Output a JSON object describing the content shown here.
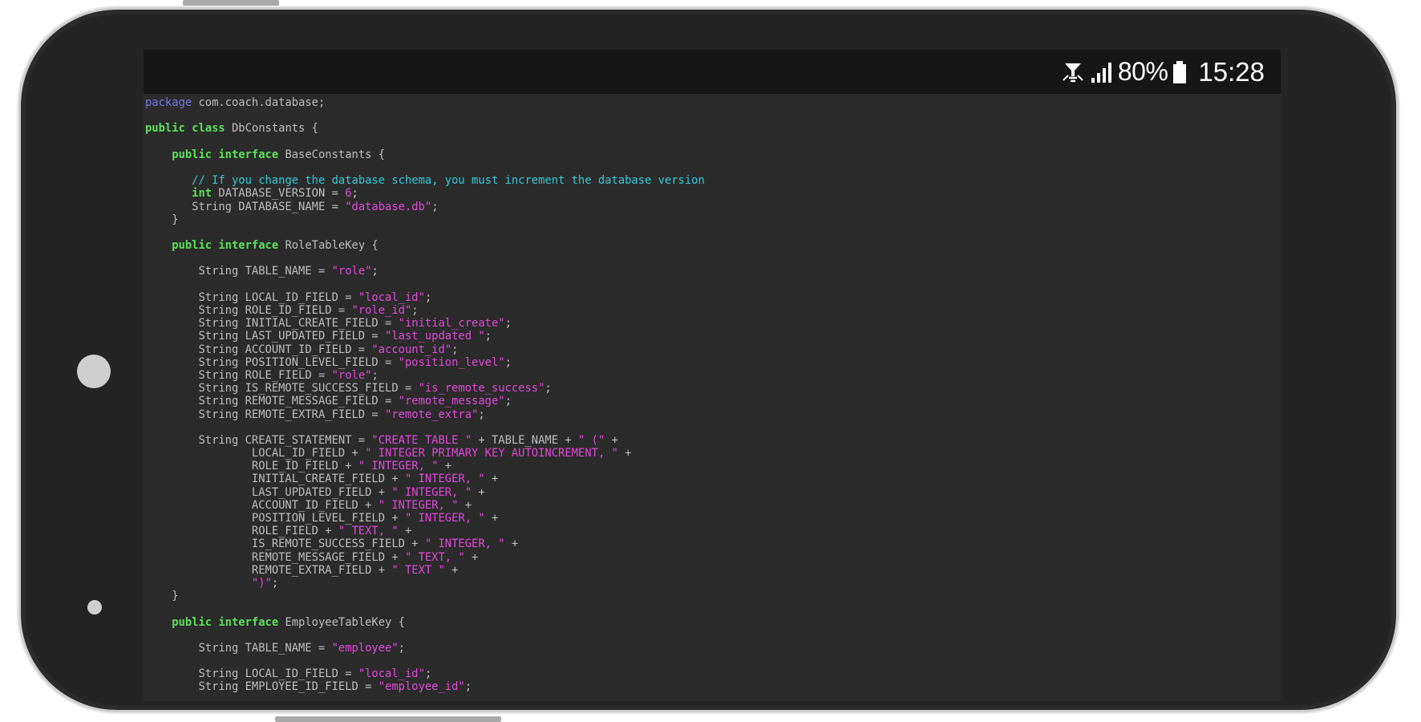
{
  "status_bar": {
    "battery_percent": "80%",
    "time": "15:28",
    "icons": [
      "alarm-icon",
      "signal-icon",
      "battery-icon"
    ]
  },
  "colors": {
    "keyword": "#5be05b",
    "package_keyword": "#7474e6",
    "string": "#e048d8",
    "comment": "#33c9d8",
    "plain": "#bdbdbd",
    "editor_background": "#2b2b2b"
  },
  "code": {
    "language": "java",
    "lines": [
      [
        {
          "t": "package",
          "c": "pkg"
        },
        {
          "t": " com.coach.database;",
          "c": "pl"
        }
      ],
      [],
      [
        {
          "t": "public class",
          "c": "kw"
        },
        {
          "t": " DbConstants {",
          "c": "pl"
        }
      ],
      [],
      [
        {
          "t": "    ",
          "c": "pl"
        },
        {
          "t": "public interface",
          "c": "kw"
        },
        {
          "t": " BaseConstants {",
          "c": "pl"
        }
      ],
      [],
      [
        {
          "t": "       ",
          "c": "pl"
        },
        {
          "t": "// If you change the database schema, you must increment the database version",
          "c": "cm"
        }
      ],
      [
        {
          "t": "       ",
          "c": "pl"
        },
        {
          "t": "int",
          "c": "kw"
        },
        {
          "t": " DATABASE_VERSION = ",
          "c": "pl"
        },
        {
          "t": "6",
          "c": "num"
        },
        {
          "t": ";",
          "c": "pl"
        }
      ],
      [
        {
          "t": "       String DATABASE_NAME = ",
          "c": "pl"
        },
        {
          "t": "\"database.db\"",
          "c": "str"
        },
        {
          "t": ";",
          "c": "pl"
        }
      ],
      [
        {
          "t": "    }",
          "c": "pl"
        }
      ],
      [],
      [
        {
          "t": "    ",
          "c": "pl"
        },
        {
          "t": "public interface",
          "c": "kw"
        },
        {
          "t": " RoleTableKey {",
          "c": "pl"
        }
      ],
      [],
      [
        {
          "t": "        String TABLE_NAME = ",
          "c": "pl"
        },
        {
          "t": "\"role\"",
          "c": "str"
        },
        {
          "t": ";",
          "c": "pl"
        }
      ],
      [],
      [
        {
          "t": "        String LOCAL_ID_FIELD = ",
          "c": "pl"
        },
        {
          "t": "\"local_id\"",
          "c": "str"
        },
        {
          "t": ";",
          "c": "pl"
        }
      ],
      [
        {
          "t": "        String ROLE_ID_FIELD = ",
          "c": "pl"
        },
        {
          "t": "\"role_id\"",
          "c": "str"
        },
        {
          "t": ";",
          "c": "pl"
        }
      ],
      [
        {
          "t": "        String INITIAL_CREATE_FIELD = ",
          "c": "pl"
        },
        {
          "t": "\"initial_create\"",
          "c": "str"
        },
        {
          "t": ";",
          "c": "pl"
        }
      ],
      [
        {
          "t": "        String LAST_UPDATED_FIELD = ",
          "c": "pl"
        },
        {
          "t": "\"last_updated \"",
          "c": "str"
        },
        {
          "t": ";",
          "c": "pl"
        }
      ],
      [
        {
          "t": "        String ACCOUNT_ID_FIELD = ",
          "c": "pl"
        },
        {
          "t": "\"account_id\"",
          "c": "str"
        },
        {
          "t": ";",
          "c": "pl"
        }
      ],
      [
        {
          "t": "        String POSITION_LEVEL_FIELD = ",
          "c": "pl"
        },
        {
          "t": "\"position_level\"",
          "c": "str"
        },
        {
          "t": ";",
          "c": "pl"
        }
      ],
      [
        {
          "t": "        String ROLE_FIELD = ",
          "c": "pl"
        },
        {
          "t": "\"role\"",
          "c": "str"
        },
        {
          "t": ";",
          "c": "pl"
        }
      ],
      [
        {
          "t": "        String IS_REMOTE_SUCCESS_FIELD = ",
          "c": "pl"
        },
        {
          "t": "\"is_remote_success\"",
          "c": "str"
        },
        {
          "t": ";",
          "c": "pl"
        }
      ],
      [
        {
          "t": "        String REMOTE_MESSAGE_FIELD = ",
          "c": "pl"
        },
        {
          "t": "\"remote_message\"",
          "c": "str"
        },
        {
          "t": ";",
          "c": "pl"
        }
      ],
      [
        {
          "t": "        String REMOTE_EXTRA_FIELD = ",
          "c": "pl"
        },
        {
          "t": "\"remote_extra\"",
          "c": "str"
        },
        {
          "t": ";",
          "c": "pl"
        }
      ],
      [],
      [
        {
          "t": "        String CREATE_STATEMENT = ",
          "c": "pl"
        },
        {
          "t": "\"CREATE TABLE \"",
          "c": "str"
        },
        {
          "t": " + TABLE_NAME + ",
          "c": "pl"
        },
        {
          "t": "\" (\"",
          "c": "str"
        },
        {
          "t": " +",
          "c": "pl"
        }
      ],
      [
        {
          "t": "                LOCAL_ID_FIELD + ",
          "c": "pl"
        },
        {
          "t": "\" INTEGER PRIMARY KEY AUTOINCREMENT, \"",
          "c": "str"
        },
        {
          "t": " +",
          "c": "pl"
        }
      ],
      [
        {
          "t": "                ROLE_ID_FIELD + ",
          "c": "pl"
        },
        {
          "t": "\" INTEGER, \"",
          "c": "str"
        },
        {
          "t": " +",
          "c": "pl"
        }
      ],
      [
        {
          "t": "                INITIAL_CREATE_FIELD + ",
          "c": "pl"
        },
        {
          "t": "\" INTEGER, \"",
          "c": "str"
        },
        {
          "t": " +",
          "c": "pl"
        }
      ],
      [
        {
          "t": "                LAST_UPDATED_FIELD + ",
          "c": "pl"
        },
        {
          "t": "\" INTEGER, \"",
          "c": "str"
        },
        {
          "t": " +",
          "c": "pl"
        }
      ],
      [
        {
          "t": "                ACCOUNT_ID_FIELD + ",
          "c": "pl"
        },
        {
          "t": "\" INTEGER, \"",
          "c": "str"
        },
        {
          "t": " +",
          "c": "pl"
        }
      ],
      [
        {
          "t": "                POSITION_LEVEL_FIELD + ",
          "c": "pl"
        },
        {
          "t": "\" INTEGER, \"",
          "c": "str"
        },
        {
          "t": " +",
          "c": "pl"
        }
      ],
      [
        {
          "t": "                ROLE_FIELD + ",
          "c": "pl"
        },
        {
          "t": "\" TEXT, \"",
          "c": "str"
        },
        {
          "t": " +",
          "c": "pl"
        }
      ],
      [
        {
          "t": "                IS_REMOTE_SUCCESS_FIELD + ",
          "c": "pl"
        },
        {
          "t": "\" INTEGER, \"",
          "c": "str"
        },
        {
          "t": " +",
          "c": "pl"
        }
      ],
      [
        {
          "t": "                REMOTE_MESSAGE_FIELD + ",
          "c": "pl"
        },
        {
          "t": "\" TEXT, \"",
          "c": "str"
        },
        {
          "t": " +",
          "c": "pl"
        }
      ],
      [
        {
          "t": "                REMOTE_EXTRA_FIELD + ",
          "c": "pl"
        },
        {
          "t": "\" TEXT \"",
          "c": "str"
        },
        {
          "t": " +",
          "c": "pl"
        }
      ],
      [
        {
          "t": "                ",
          "c": "pl"
        },
        {
          "t": "\")\"",
          "c": "str"
        },
        {
          "t": ";",
          "c": "pl"
        }
      ],
      [
        {
          "t": "    }",
          "c": "pl"
        }
      ],
      [],
      [
        {
          "t": "    ",
          "c": "pl"
        },
        {
          "t": "public interface",
          "c": "kw"
        },
        {
          "t": " EmployeeTableKey {",
          "c": "pl"
        }
      ],
      [],
      [
        {
          "t": "        String TABLE_NAME = ",
          "c": "pl"
        },
        {
          "t": "\"employee\"",
          "c": "str"
        },
        {
          "t": ";",
          "c": "pl"
        }
      ],
      [],
      [
        {
          "t": "        String LOCAL_ID_FIELD = ",
          "c": "pl"
        },
        {
          "t": "\"local_id\"",
          "c": "str"
        },
        {
          "t": ";",
          "c": "pl"
        }
      ],
      [
        {
          "t": "        String EMPLOYEE_ID_FIELD = ",
          "c": "pl"
        },
        {
          "t": "\"employee_id\"",
          "c": "str"
        },
        {
          "t": ";",
          "c": "pl"
        }
      ]
    ]
  }
}
